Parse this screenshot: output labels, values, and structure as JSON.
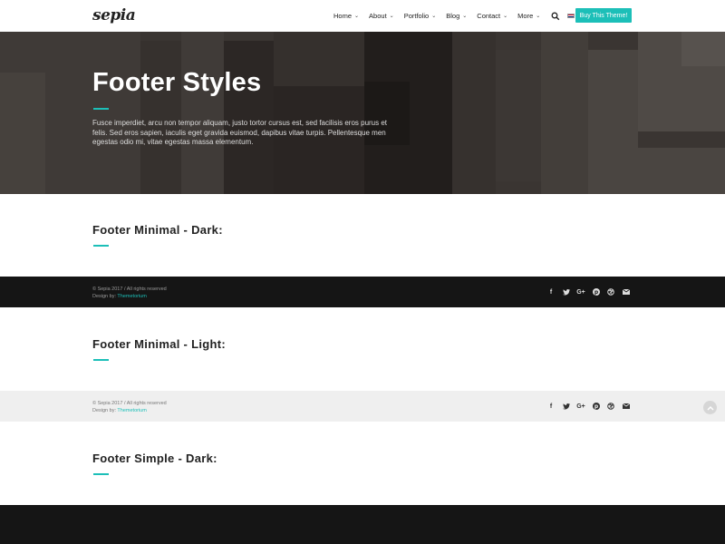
{
  "header": {
    "logo": "sepia",
    "nav": [
      {
        "label": "Home",
        "chevron": "⌄"
      },
      {
        "label": "About",
        "chevron": "⌄"
      },
      {
        "label": "Portfolio",
        "chevron": "⌄"
      },
      {
        "label": "Blog",
        "chevron": "⌄"
      },
      {
        "label": "Contact",
        "chevron": "⌄"
      },
      {
        "label": "More",
        "chevron": "⌄"
      }
    ],
    "lang": "EN",
    "buy_label": "Buy This Theme!"
  },
  "hero": {
    "title": "Footer Styles",
    "text": "Fusce imperdiet, arcu non tempor aliquam, justo tortor cursus est, sed facilisis eros purus et felis. Sed eros sapien, iaculis eget gravida euismod, dapibus vitae turpis. Pellentesque men egestas odio mi, vitae egestas massa elementum."
  },
  "sections": [
    {
      "title": "Footer Minimal - Dark:"
    },
    {
      "title": "Footer Minimal - Light:"
    },
    {
      "title": "Footer Simple - Dark:"
    }
  ],
  "footer": {
    "copyright": "© Sepia 2017 / All rights reserved",
    "design_prefix": "Design by: ",
    "design_link": "Themetorium"
  },
  "socials": [
    {
      "icon": "facebook-icon",
      "glyph": "f"
    },
    {
      "icon": "twitter-icon",
      "glyph": "🐦"
    },
    {
      "icon": "google-plus-icon",
      "glyph": "G+"
    },
    {
      "icon": "pinterest-icon",
      "glyph": "℗"
    },
    {
      "icon": "dribbble-icon",
      "glyph": "⊛"
    },
    {
      "icon": "envelope-icon",
      "glyph": "✉"
    }
  ],
  "colors": {
    "accent": "#1cbfb8",
    "dark_footer": "#151515",
    "light_footer": "#efefef"
  }
}
